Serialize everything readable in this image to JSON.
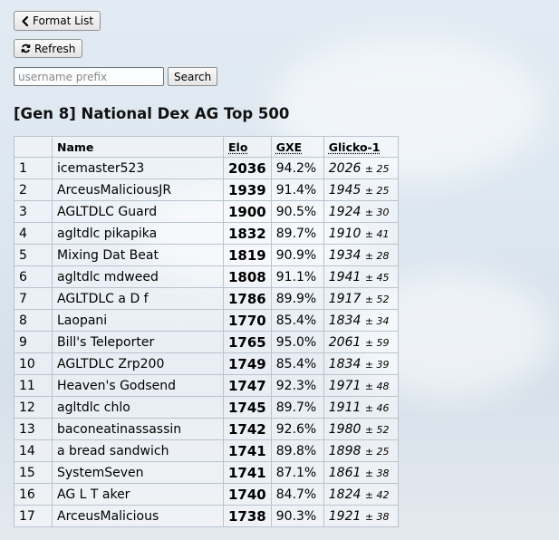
{
  "toolbar": {
    "back_label": "Format List",
    "refresh_label": "Refresh",
    "search_placeholder": "username prefix",
    "search_value": "",
    "search_label": "Search"
  },
  "page_title": "[Gen 8] National Dex AG Top 500",
  "table": {
    "headers": {
      "rank": "",
      "name": "Name",
      "elo": "Elo",
      "gxe": "GXE",
      "glicko": "Glicko-1"
    },
    "rows": [
      {
        "rank": "1",
        "name": "icemaster523",
        "elo": "2036",
        "gxe": "94.2%",
        "glicko": "2026",
        "glicko_dev": "± 25"
      },
      {
        "rank": "2",
        "name": "ArceusMaliciousJR",
        "elo": "1939",
        "gxe": "91.4%",
        "glicko": "1945",
        "glicko_dev": "± 25"
      },
      {
        "rank": "3",
        "name": "AGLTDLC Guard",
        "elo": "1900",
        "gxe": "90.5%",
        "glicko": "1924",
        "glicko_dev": "± 30"
      },
      {
        "rank": "4",
        "name": "agltdlc pikapika",
        "elo": "1832",
        "gxe": "89.7%",
        "glicko": "1910",
        "glicko_dev": "± 41"
      },
      {
        "rank": "5",
        "name": "Mixing Dat Beat",
        "elo": "1819",
        "gxe": "90.9%",
        "glicko": "1934",
        "glicko_dev": "± 28"
      },
      {
        "rank": "6",
        "name": "agltdlc mdweed",
        "elo": "1808",
        "gxe": "91.1%",
        "glicko": "1941",
        "glicko_dev": "± 45"
      },
      {
        "rank": "7",
        "name": "AGLTDLC a D f",
        "elo": "1786",
        "gxe": "89.9%",
        "glicko": "1917",
        "glicko_dev": "± 52"
      },
      {
        "rank": "8",
        "name": "Laopani",
        "elo": "1770",
        "gxe": "85.4%",
        "glicko": "1834",
        "glicko_dev": "± 34"
      },
      {
        "rank": "9",
        "name": "Bill's Teleporter",
        "elo": "1765",
        "gxe": "95.0%",
        "glicko": "2061",
        "glicko_dev": "± 59"
      },
      {
        "rank": "10",
        "name": "AGLTDLC Zrp200",
        "elo": "1749",
        "gxe": "85.4%",
        "glicko": "1834",
        "glicko_dev": "± 39"
      },
      {
        "rank": "11",
        "name": "Heaven's Godsend",
        "elo": "1747",
        "gxe": "92.3%",
        "glicko": "1971",
        "glicko_dev": "± 48"
      },
      {
        "rank": "12",
        "name": "agltdlc chlo",
        "elo": "1745",
        "gxe": "89.7%",
        "glicko": "1911",
        "glicko_dev": "± 46"
      },
      {
        "rank": "13",
        "name": "baconeatinassassin",
        "elo": "1742",
        "gxe": "92.6%",
        "glicko": "1980",
        "glicko_dev": "± 52"
      },
      {
        "rank": "14",
        "name": "a bread sandwich",
        "elo": "1741",
        "gxe": "89.8%",
        "glicko": "1898",
        "glicko_dev": "± 25"
      },
      {
        "rank": "15",
        "name": "SystemSeven",
        "elo": "1741",
        "gxe": "87.1%",
        "glicko": "1861",
        "glicko_dev": "± 38"
      },
      {
        "rank": "16",
        "name": "AG L T aker",
        "elo": "1740",
        "gxe": "84.7%",
        "glicko": "1824",
        "glicko_dev": "± 42"
      },
      {
        "rank": "17",
        "name": "ArceusMalicious",
        "elo": "1738",
        "gxe": "90.3%",
        "glicko": "1921",
        "glicko_dev": "± 38"
      }
    ]
  },
  "icons": {
    "back": "chevron-left-icon",
    "refresh": "refresh-icon"
  },
  "colors": {
    "border": "#b9c4cf",
    "button_border": "#8f8f8f"
  }
}
